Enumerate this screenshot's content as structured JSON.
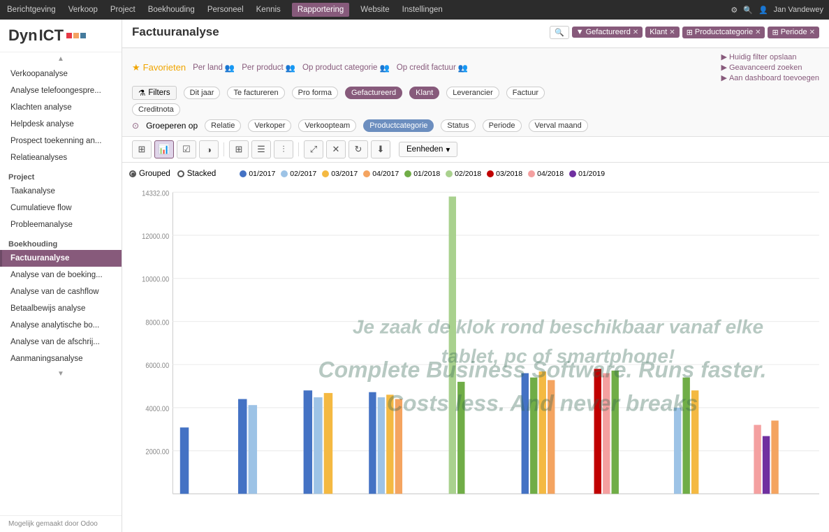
{
  "topbar": {
    "items": [
      {
        "label": "Berichtgeving",
        "active": false
      },
      {
        "label": "Verkoop",
        "active": false
      },
      {
        "label": "Project",
        "active": false
      },
      {
        "label": "Boekhouding",
        "active": false
      },
      {
        "label": "Personeel",
        "active": false
      },
      {
        "label": "Kennis",
        "active": false
      },
      {
        "label": "Rapportering",
        "active": true
      },
      {
        "label": "Website",
        "active": false
      },
      {
        "label": "Instellingen",
        "active": false
      }
    ],
    "user": "Jan Vandewey",
    "icons": [
      "settings-icon",
      "search-icon",
      "user-icon"
    ]
  },
  "sidebar": {
    "logo_dyn": "Dyn",
    "logo_ict": "ICT",
    "items": [
      {
        "label": "Verkoopanalyse",
        "active": false
      },
      {
        "label": "Analyse telefoongespre...",
        "active": false
      },
      {
        "label": "Klachten analyse",
        "active": false
      },
      {
        "label": "Helpdesk analyse",
        "active": false
      },
      {
        "label": "Prospect toekenning an...",
        "active": false
      },
      {
        "label": "Relatieanalyses",
        "active": false
      },
      {
        "label": "Project",
        "section": true
      },
      {
        "label": "Taakanalyse",
        "active": false
      },
      {
        "label": "Cumulatieve flow",
        "active": false
      },
      {
        "label": "Probleemanalyse",
        "active": false
      },
      {
        "label": "Boekhouding",
        "section": true
      },
      {
        "label": "Factuuranalyse",
        "active": true
      },
      {
        "label": "Analyse van de boeking...",
        "active": false
      },
      {
        "label": "Analyse van de cashflow",
        "active": false
      },
      {
        "label": "Betaalbewijs analyse",
        "active": false
      },
      {
        "label": "Analyse analytische bo...",
        "active": false
      },
      {
        "label": "Analyse van de afschrij...",
        "active": false
      },
      {
        "label": "Aanmaningsanalyse",
        "active": false
      }
    ],
    "footer": "Mogelijk gemaakt door Odoo"
  },
  "header": {
    "title": "Factuuranalyse"
  },
  "filter_chips": {
    "search_placeholder": "Zoeken...",
    "chips": [
      {
        "label": "Gefactureerd",
        "type": "filter"
      },
      {
        "label": "Klant",
        "type": "klant"
      },
      {
        "label": "Productcategorie",
        "type": "productcat"
      },
      {
        "label": "Periode",
        "type": "periode"
      }
    ]
  },
  "controls": {
    "favorites_label": "Favorieten",
    "per_land_label": "Per land",
    "per_product_label": "Per product",
    "op_product_cat_label": "Op product categorie",
    "op_credit_factuur_label": "Op credit factuur",
    "huidig_filter_label": "Huidig filter opslaan",
    "geavanceerd_label": "Geavanceerd zoeken",
    "dashboard_label": "Aan dashboard toevoegen",
    "filters_label": "Filters",
    "dit_jaar_label": "Dit jaar",
    "te_factureren_label": "Te factureren",
    "pro_forma_label": "Pro forma",
    "gefactureerd_label": "Gefactureerd",
    "klant_label": "Klant",
    "leverancier_label": "Leverancier",
    "factuur_label": "Factuur",
    "creditnota_label": "Creditnota",
    "groeperen_op_label": "Groeperen op",
    "relatie_label": "Relatie",
    "verkoper_label": "Verkoper",
    "verkoopteam_label": "Verkoopteam",
    "productcategorie_label": "Productcategorie",
    "status_label": "Status",
    "periode_label": "Periode",
    "verval_maand_label": "Verval maand"
  },
  "toolbar": {
    "units_label": "Eenheden",
    "tools": [
      {
        "name": "table-icon",
        "symbol": "⊞",
        "active": false
      },
      {
        "name": "bar-chart-icon",
        "symbol": "📊",
        "active": true
      },
      {
        "name": "check-icon",
        "symbol": "☑",
        "active": false
      },
      {
        "name": "circle-icon",
        "symbol": "◑",
        "active": false
      },
      {
        "name": "grid-icon",
        "symbol": "⊞",
        "active": false
      },
      {
        "name": "list-icon",
        "symbol": "☰",
        "active": false
      },
      {
        "name": "columns-icon",
        "symbol": "⫶",
        "active": false
      },
      {
        "name": "expand-icon",
        "symbol": "⤢",
        "active": false
      },
      {
        "name": "close-icon",
        "symbol": "✕",
        "active": false
      },
      {
        "name": "refresh-icon",
        "symbol": "↻",
        "active": false
      },
      {
        "name": "download-icon",
        "symbol": "⬇",
        "active": false
      }
    ]
  },
  "chart": {
    "grouped_label": "Grouped",
    "stacked_label": "Stacked",
    "y_values": [
      "14332.00",
      "12000.00",
      "10000.00",
      "8000.00",
      "6000.00",
      "4000.00",
      "2000.00"
    ],
    "legend": [
      {
        "label": "01/2017",
        "color": "#4472c4"
      },
      {
        "label": "02/2017",
        "color": "#9dc3e6"
      },
      {
        "label": "03/2017",
        "color": "#f4b942"
      },
      {
        "label": "04/2017",
        "color": "#f4a460"
      },
      {
        "label": "01/2018",
        "color": "#70ad47"
      },
      {
        "label": "02/2018",
        "color": "#a9d18e"
      },
      {
        "label": "03/2018",
        "color": "#c00000"
      },
      {
        "label": "04/2018",
        "color": "#f4a0a0"
      },
      {
        "label": "01/2019",
        "color": "#7030a0"
      }
    ],
    "watermark1": "Je zaak de klok rond beschikbaar vanaf elke tablet, pc of smartphone!",
    "watermark2": "Complete Business Software. Runs faster. Costs less. And never breaks"
  }
}
